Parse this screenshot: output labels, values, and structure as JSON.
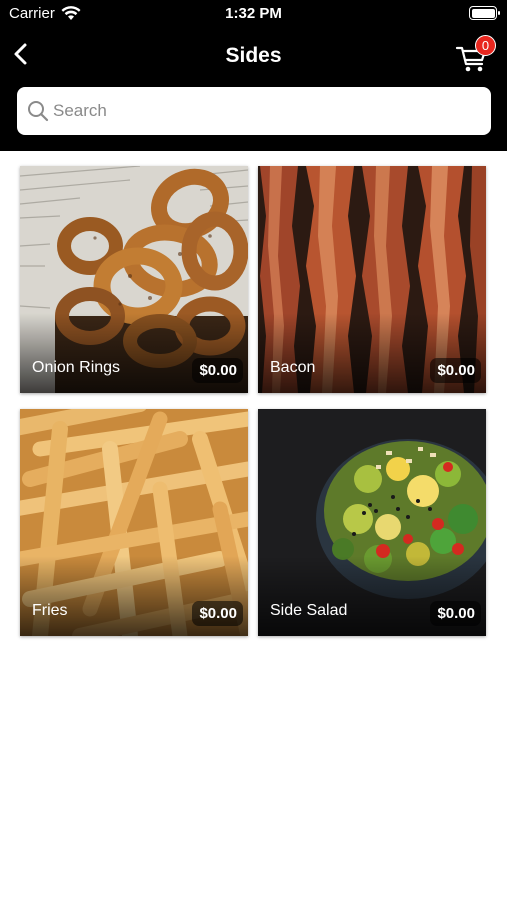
{
  "status_bar": {
    "carrier": "Carrier",
    "time": "1:32 PM",
    "wifi_icon": "wifi-icon",
    "battery_icon": "battery-icon"
  },
  "nav": {
    "title": "Sides",
    "back_icon": "chevron-left-icon",
    "cart_icon": "cart-icon",
    "cart_count": "0",
    "badge_color": "#e8271f"
  },
  "search": {
    "placeholder": "Search",
    "value": "",
    "icon": "search-icon"
  },
  "items": [
    {
      "name": "Onion Rings",
      "price": "$0.00"
    },
    {
      "name": "Bacon",
      "price": "$0.00"
    },
    {
      "name": "Fries",
      "price": "$0.00"
    },
    {
      "name": "Side Salad",
      "price": "$0.00"
    }
  ]
}
